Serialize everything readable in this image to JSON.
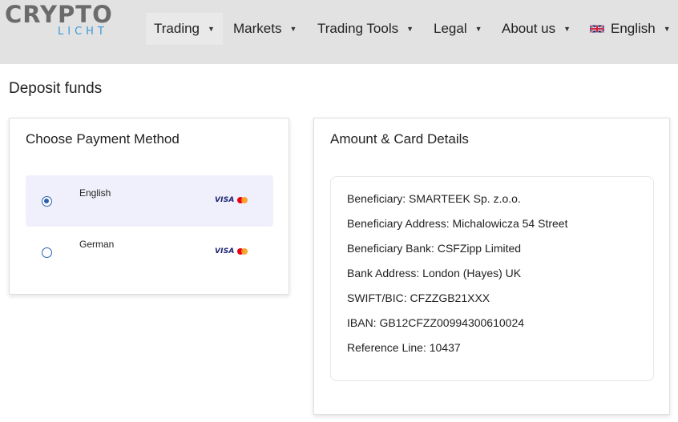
{
  "brand": {
    "logo_top": "CRYPTO",
    "logo_bottom": "LICHT"
  },
  "nav": {
    "items": [
      {
        "label": "Trading"
      },
      {
        "label": "Markets"
      },
      {
        "label": "Trading Tools"
      },
      {
        "label": "Legal"
      },
      {
        "label": "About us"
      }
    ],
    "language": "English",
    "language_flag": "uk-flag-icon"
  },
  "page": {
    "title": "Deposit funds"
  },
  "payment_method": {
    "title": "Choose Payment Method",
    "options": [
      {
        "label": "English",
        "selected": true,
        "logos": [
          "visa-icon",
          "mastercard-icon"
        ]
      },
      {
        "label": "German",
        "selected": false,
        "logos": [
          "visa-icon",
          "mastercard-icon"
        ]
      }
    ],
    "visa_text": "VISA"
  },
  "card_details": {
    "title": "Amount & Card Details",
    "lines": [
      "Beneficiary: SMARTEEK Sp. z.o.o.",
      "Beneficiary Address: Michalowicza 54 Street",
      "Beneficiary Bank: CSFZipp Limited",
      "Bank Address: London (Hayes) UK",
      "SWIFT/BIC: CFZZGB21XXX",
      "IBAN: GB12CFZZ00994300610024",
      "Reference Line: 10437"
    ]
  },
  "colors": {
    "header_bg": "#e2e2e2",
    "accent_blue": "#3a9ad9",
    "radio_blue": "#2a5fb0",
    "selected_row_bg": "#eff0fb"
  }
}
